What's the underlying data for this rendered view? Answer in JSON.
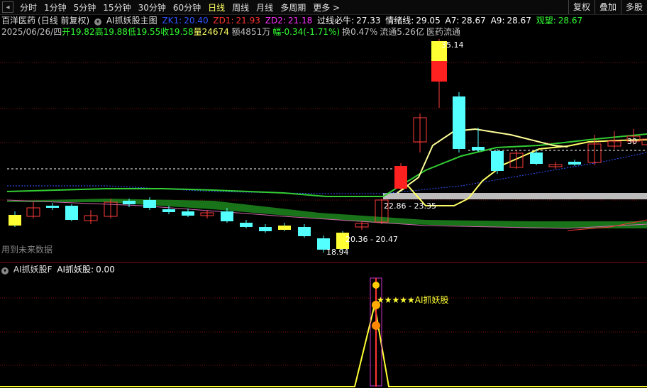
{
  "toolbar": {
    "periods": [
      "分时",
      "1分钟",
      "5分钟",
      "15分钟",
      "30分钟",
      "60分钟",
      "日线",
      "周线",
      "月线",
      "多周期",
      "更多 >"
    ],
    "active": "日线",
    "right_buttons": [
      "复权",
      "叠加",
      "多股"
    ]
  },
  "header": {
    "stock_name": "百洋医药",
    "period_note": "(日线 前复权)",
    "main_indicator": "AI抓妖股主图",
    "zk1_label": "ZK1:",
    "zk1_value": "20.40",
    "zd1_label": "ZD1:",
    "zd1_value": "21.93",
    "zd2_label": "ZD2:",
    "zd2_value": "21.18",
    "guoxian_label": "过线必牛:",
    "guoxian_value": "27.33",
    "qingxu_label": "情绪线:",
    "qingxu_value": "29.05",
    "a7_label": "A7:",
    "a7_value": "28.67",
    "a9_label": "A9:",
    "a9_value": "28.67",
    "guanwang_label": "观望:",
    "guanwang_value": "28.67"
  },
  "quote": {
    "date": "2025/06/26/四",
    "open": "开19.82",
    "high": "高19.88",
    "low": "低19.55",
    "close": "收19.58",
    "volume": "量24674",
    "amount": "额4851万",
    "change": "幅-0.34(-1.71%)",
    "turnover": "换0.47%",
    "float": "流通5.26亿",
    "sector": "医药流通"
  },
  "main_chart": {
    "annotations": {
      "high_label": "35.14",
      "low_label": "18.94",
      "range1": "22.86 - 23.35",
      "range2": "20.36 - 20.47",
      "right_value": "30",
      "future_data": "用到未来数据"
    },
    "colors": {
      "up": "#ff3b3b",
      "down": "#54ffff",
      "green_band": "#1a7a1a",
      "yellow_line": "#ffff66",
      "ma_green": "#33cc33"
    }
  },
  "sub_panel": {
    "title": "AI抓妖股F",
    "value_label": "AI抓妖股:",
    "value": "0.00",
    "signal_text": "★★★★★AI抓妖股"
  }
}
